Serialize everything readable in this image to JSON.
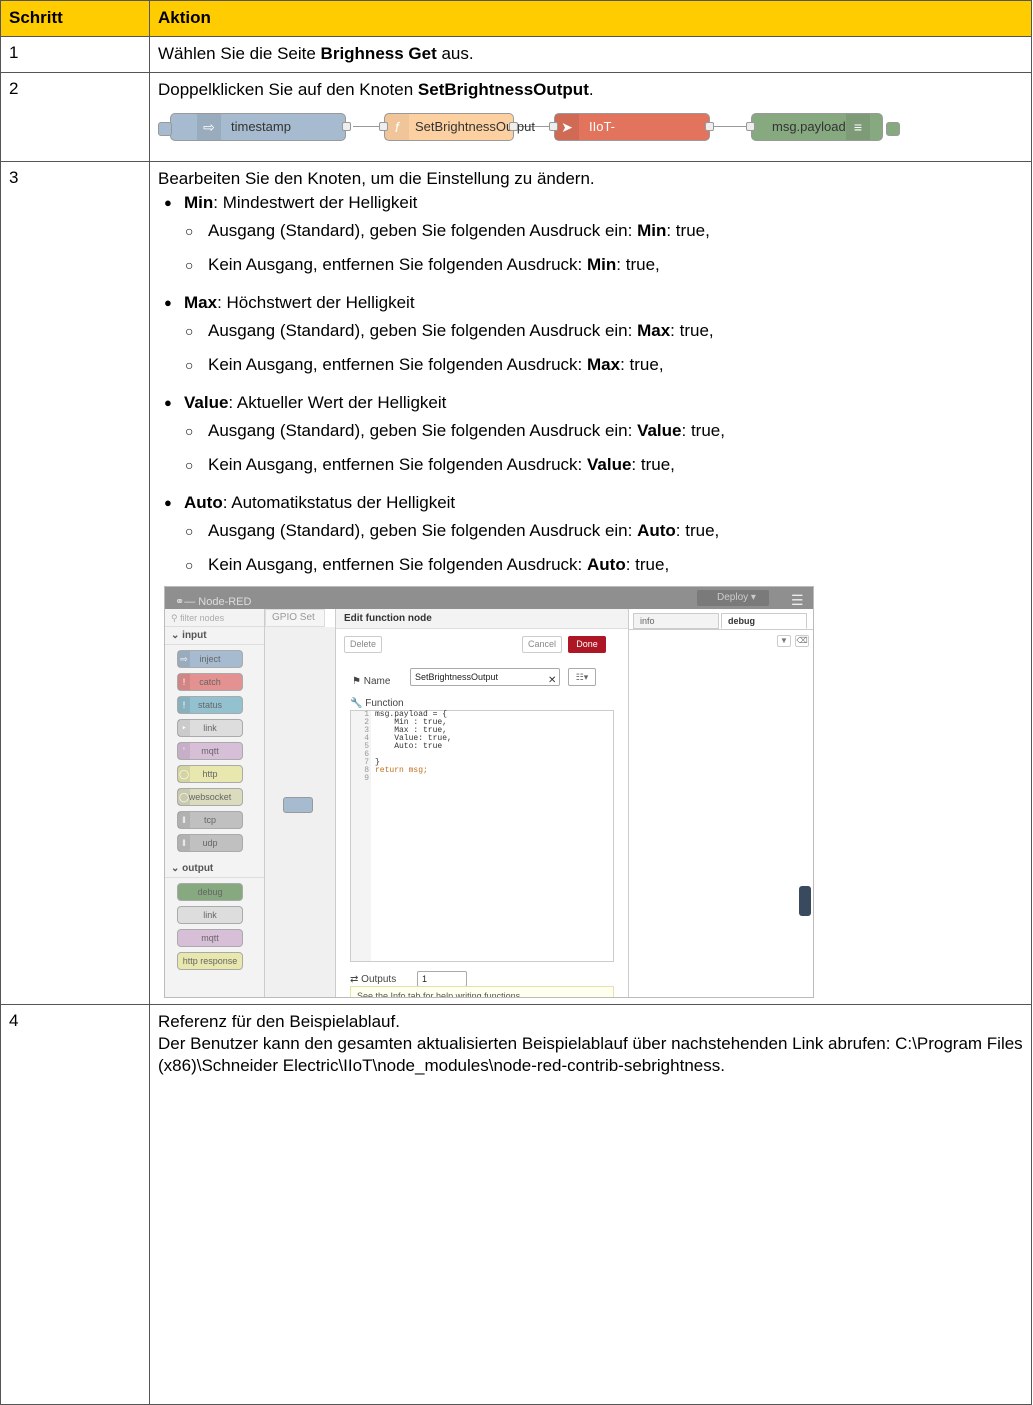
{
  "table": {
    "headers": {
      "step": "Schritt",
      "action": "Aktion"
    }
  },
  "rows": {
    "r1": {
      "num": "1",
      "pre": "Wählen Sie die Seite ",
      "bold": "Brighness Get",
      "post": " aus."
    },
    "r2": {
      "num": "2",
      "pre": "Doppelklicken Sie auf den Knoten ",
      "bold": "SetBrightnessOutput",
      "post": "."
    },
    "r3": {
      "num": "3",
      "intro": "Bearbeiten Sie den Knoten, um die Einstellung zu ändern.",
      "items": [
        {
          "key": "Min",
          "desc": ": Mindestwert der Helligkeit",
          "sub1_pre": "Ausgang (Standard), geben Sie folgenden Ausdruck ein: ",
          "sub1_post": ": true,",
          "sub2_pre": "Kein Ausgang, entfernen Sie folgenden Ausdruck: ",
          "sub2_post": ": true,"
        },
        {
          "key": "Max",
          "desc": ": Höchstwert der Helligkeit",
          "sub1_pre": "Ausgang (Standard), geben Sie folgenden Ausdruck ein: ",
          "sub1_post": ": true,",
          "sub2_pre": "Kein Ausgang, entfernen Sie folgenden Ausdruck: ",
          "sub2_post": ": true,"
        },
        {
          "key": "Value",
          "desc": ": Aktueller Wert der Helligkeit",
          "sub1_pre": "Ausgang (Standard), geben Sie folgenden Ausdruck ein: ",
          "sub1_post": ": true,",
          "sub2_pre": "Kein Ausgang, entfernen Sie folgenden Ausdruck: ",
          "sub2_post": ": true,"
        },
        {
          "key": "Auto",
          "desc": ": Automatikstatus der Helligkeit",
          "sub1_pre": "Ausgang (Standard), geben Sie folgenden Ausdruck ein: ",
          "sub1_post": ": true,",
          "sub2_pre": "Kein Ausgang, entfernen Sie folgenden Ausdruck: ",
          "sub2_post": ": true,"
        }
      ]
    },
    "r4": {
      "num": "4",
      "line1": "Referenz für den Beispielablauf.",
      "line2": "Der Benutzer kann den gesamten aktualisierten Beispielablauf über nachstehenden Link abrufen: C:\\Program Files (x86)\\Schneider Electric\\IIoT\\node_modules\\node-red-contrib-sebrightness."
    }
  },
  "flow": {
    "nodes": [
      "timestamp",
      "SetBrightnessOutput",
      "IIoT-Brightness_Data_Get",
      "msg.payload"
    ],
    "colors": {
      "inject": "#a6bbcf",
      "function": "#fdd0a2",
      "iiot": "#e2735c",
      "debug": "#87a980"
    }
  },
  "nodered": {
    "app_title": "Node-RED",
    "deploy_label": "Deploy",
    "filter_placeholder": "filter nodes",
    "cat_input": "input",
    "cat_output": "output",
    "palette_input": [
      "inject",
      "catch",
      "status",
      "link",
      "mqtt",
      "http",
      "websocket",
      "tcp",
      "udp"
    ],
    "palette_output": [
      "debug",
      "link",
      "mqtt",
      "http response"
    ],
    "canvas_tab": "GPIO Set",
    "editor_title": "Edit function node",
    "delete_label": "Delete",
    "cancel_label": "Cancel",
    "done_label": "Done",
    "name_label": "Name",
    "name_value": "SetBrightnessOutput",
    "function_label": "Function",
    "code_lines": [
      "msg.payload = {",
      "    Min : true,",
      "    Max : true,",
      "    Value: true,",
      "    Auto: true",
      "",
      "}",
      "return msg;",
      ""
    ],
    "outputs_label": "Outputs",
    "outputs_value": "1",
    "hint": "See the Info tab for help writing functions.",
    "tab_info": "info",
    "tab_debug": "debug"
  }
}
